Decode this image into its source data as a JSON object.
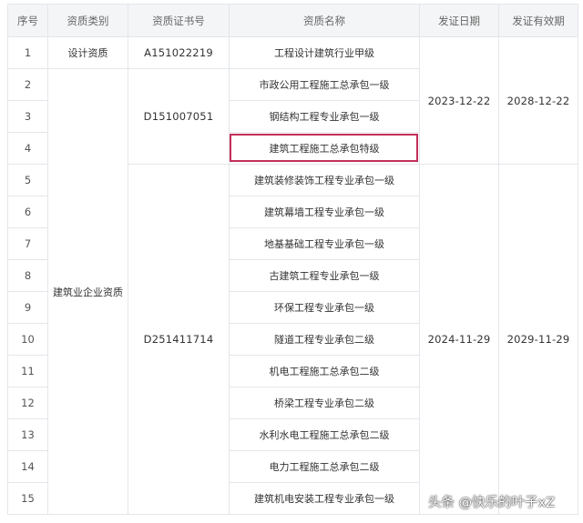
{
  "table": {
    "headers": [
      "序号",
      "资质类别",
      "资质证书号",
      "资质名称",
      "发证日期",
      "发证有效期"
    ],
    "rows": [
      {
        "no": "1",
        "name": "工程设计建筑行业甲级"
      },
      {
        "no": "2",
        "name": "市政公用工程施工总承包一级"
      },
      {
        "no": "3",
        "name": "钢结构工程专业承包一级"
      },
      {
        "no": "4",
        "name": "建筑工程施工总承包特级"
      },
      {
        "no": "5",
        "name": "建筑装修装饰工程专业承包一级"
      },
      {
        "no": "6",
        "name": "建筑幕墙工程专业承包一级"
      },
      {
        "no": "7",
        "name": "地基基础工程专业承包一级"
      },
      {
        "no": "8",
        "name": "古建筑工程专业承包一级"
      },
      {
        "no": "9",
        "name": "环保工程专业承包一级"
      },
      {
        "no": "10",
        "name": "隧道工程专业承包二级"
      },
      {
        "no": "11",
        "name": "机电工程施工总承包二级"
      },
      {
        "no": "12",
        "name": "桥梁工程专业承包二级"
      },
      {
        "no": "13",
        "name": "水利水电工程施工总承包二级"
      },
      {
        "no": "14",
        "name": "电力工程施工总承包二级"
      },
      {
        "no": "15",
        "name": "建筑机电安装工程专业承包一级"
      }
    ],
    "categories": {
      "design": "设计资质",
      "construction": "建筑业企业资质"
    },
    "certificates": {
      "a": "A151022219",
      "d1": "D151007051",
      "d2": "D251411714"
    },
    "issue_dates": {
      "first": "2023-12-22",
      "second": "2024-11-29"
    },
    "valid_until": {
      "first": "2028-12-22",
      "second": "2029-11-29"
    },
    "highlight_color": "#c42e59"
  },
  "watermark": "头条 @快乐的叶子xZ"
}
